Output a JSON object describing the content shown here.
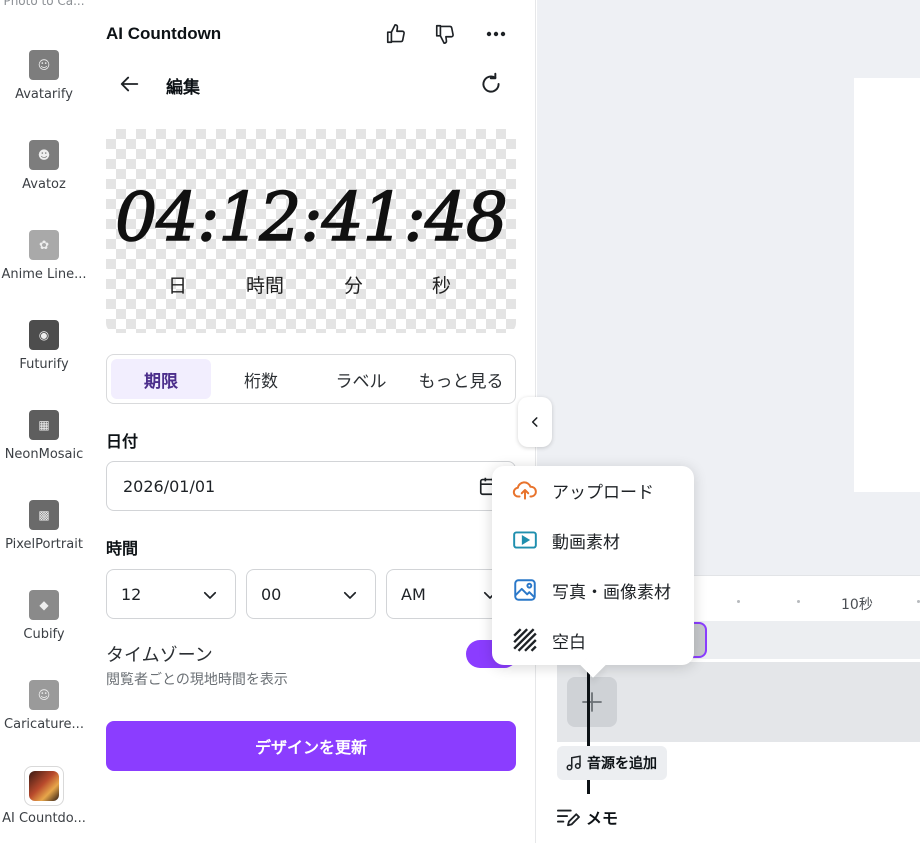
{
  "rail": {
    "top_label": "Photo to Ca...",
    "items": [
      {
        "label": "Avatarify"
      },
      {
        "label": "Avatoz"
      },
      {
        "label": "Anime Line..."
      },
      {
        "label": "Futurify"
      },
      {
        "label": "NeonMosaic"
      },
      {
        "label": "PixelPortrait"
      },
      {
        "label": "Cubify"
      },
      {
        "label": "Caricature..."
      },
      {
        "label": "AI Countdo..."
      }
    ]
  },
  "panel": {
    "app_title": "AI Countdown",
    "edit_label": "編集",
    "preview": {
      "countdown": "04:12:41:48",
      "units": [
        "日",
        "時間",
        "分",
        "秒"
      ]
    },
    "tabs": [
      {
        "label": "期限",
        "active": true
      },
      {
        "label": "桁数",
        "active": false
      },
      {
        "label": "ラベル",
        "active": false
      },
      {
        "label": "もっと見る",
        "active": false
      }
    ],
    "date_label": "日付",
    "date_value": "2026/01/01",
    "time_label": "時間",
    "hour_value": "12",
    "minute_value": "00",
    "ampm_value": "AM",
    "timezone_label": "タイムゾーン",
    "timezone_sub": "閲覧者ごとの現地時間を表示",
    "timezone_enabled": true,
    "update_button": "デザインを更新"
  },
  "timeline": {
    "ruler_label": "10秒",
    "audio_button": "音源を追加",
    "memo_label": "メモ"
  },
  "popup": {
    "items": [
      {
        "label": "アップロード",
        "icon": "cloud-upload-icon"
      },
      {
        "label": "動画素材",
        "icon": "video-play-icon"
      },
      {
        "label": "写真・画像素材",
        "icon": "image-icon"
      },
      {
        "label": "空白",
        "icon": "blank-stripes-icon"
      }
    ]
  },
  "colors": {
    "accent": "#8b3dff",
    "tab_active_bg": "#f2eefe",
    "upload_icon": "#e8732c",
    "video_icon": "#1f8fae",
    "image_icon": "#2a78c9"
  }
}
